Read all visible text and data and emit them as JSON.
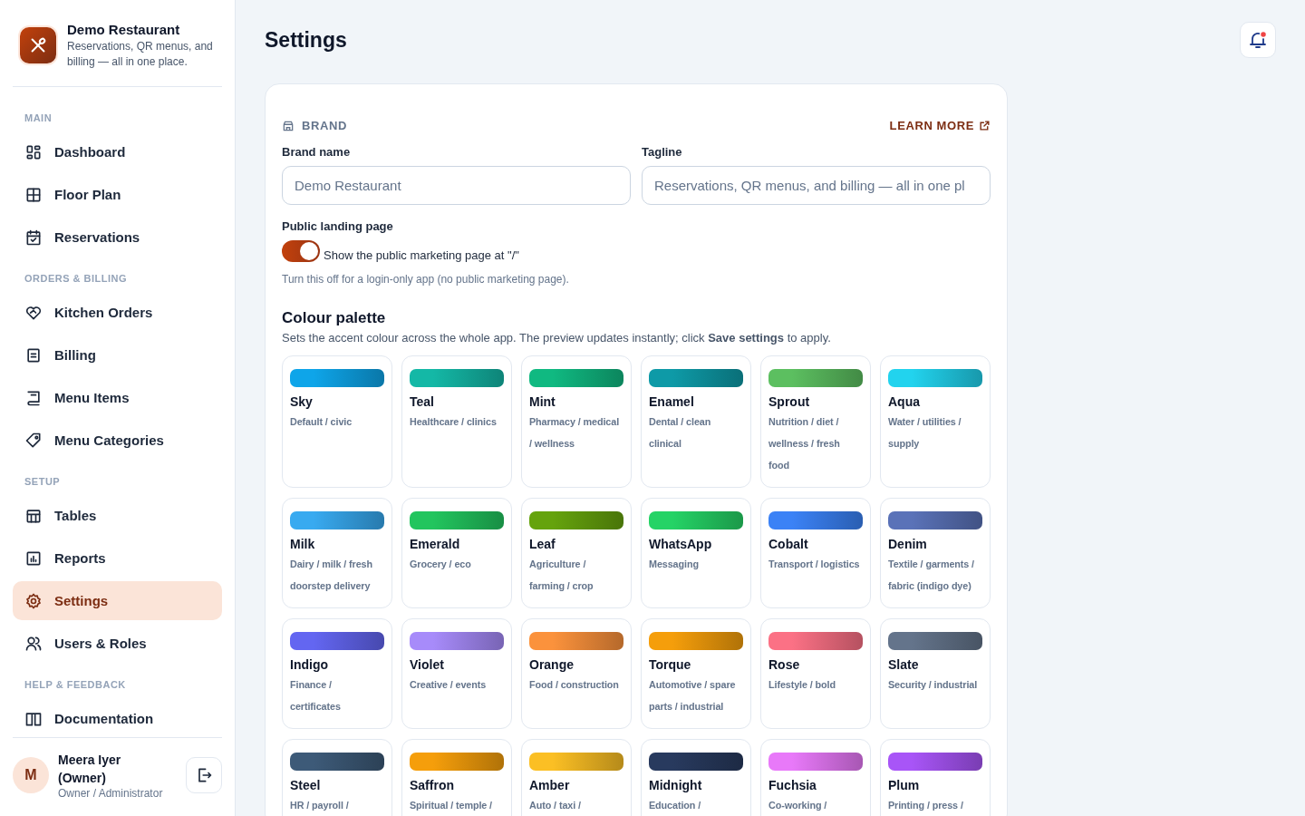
{
  "brand": {
    "name": "Demo Restaurant",
    "tagline": "Reservations, QR menus, and billing — all in one place."
  },
  "sidebar": {
    "sections": [
      {
        "title": "MAIN",
        "items": [
          {
            "label": "Dashboard",
            "selected": false
          },
          {
            "label": "Floor Plan",
            "selected": false
          },
          {
            "label": "Reservations",
            "selected": false
          }
        ]
      },
      {
        "title": "ORDERS & BILLING",
        "items": [
          {
            "label": "Kitchen Orders",
            "selected": false
          },
          {
            "label": "Billing",
            "selected": false
          },
          {
            "label": "Menu Items",
            "selected": false
          },
          {
            "label": "Menu Categories",
            "selected": false
          }
        ]
      },
      {
        "title": "SETUP",
        "items": [
          {
            "label": "Tables",
            "selected": false
          },
          {
            "label": "Reports",
            "selected": false
          },
          {
            "label": "Settings",
            "selected": true
          },
          {
            "label": "Users & Roles",
            "selected": false
          }
        ]
      },
      {
        "title": "HELP & FEEDBACK",
        "items": [
          {
            "label": "Documentation",
            "selected": false
          }
        ]
      }
    ]
  },
  "user": {
    "initial": "M",
    "name": "Meera Iyer (Owner)",
    "role": "Owner / Administrator"
  },
  "page_title": "Settings",
  "notifications": {
    "unread": true
  },
  "brand_section": {
    "title": "BRAND",
    "learn_more": "LEARN MORE",
    "fields": [
      {
        "label": "Brand name",
        "placeholder": "Demo Restaurant"
      },
      {
        "label": "Tagline",
        "placeholder": "Reservations, QR menus, and billing — all in one pl"
      }
    ],
    "landing": {
      "label": "Public landing page",
      "toggle_label": "Show the public marketing page at \"/\"",
      "on": true,
      "hint": "Turn this off for a login-only app (no public marketing page)."
    }
  },
  "palette": {
    "title": "Colour palette",
    "description": "Sets the accent colour across the whole app. The preview updates instantly; click **Save settings** to apply.",
    "items": [
      {
        "name": "Sky",
        "description": "Default / civic",
        "color": "#0ea5e9"
      },
      {
        "name": "Teal",
        "description": "Healthcare / clinics",
        "color": "#14b8a6"
      },
      {
        "name": "Mint",
        "description": "Pharmacy / medical / wellness",
        "color": "#10b981"
      },
      {
        "name": "Enamel",
        "description": "Dental / clean clinical",
        "color": "#0e9aa7"
      },
      {
        "name": "Sprout",
        "description": "Nutrition / diet / wellness / fresh food",
        "color": "#5cbf60"
      },
      {
        "name": "Aqua",
        "description": "Water / utilities / supply",
        "color": "#22d3ee"
      },
      {
        "name": "Milk",
        "description": "Dairy / milk / fresh doorstep delivery",
        "color": "#38aaf0"
      },
      {
        "name": "Emerald",
        "description": "Grocery / eco",
        "color": "#22c55e"
      },
      {
        "name": "Leaf",
        "description": "Agriculture / farming / crop",
        "color": "#65a30d"
      },
      {
        "name": "WhatsApp",
        "description": "Messaging",
        "color": "#25d366"
      },
      {
        "name": "Cobalt",
        "description": "Transport / logistics",
        "color": "#3b82f6"
      },
      {
        "name": "Denim",
        "description": "Textile / garments / fabric (indigo dye)",
        "color": "#5a72b8"
      },
      {
        "name": "Indigo",
        "description": "Finance / certificates",
        "color": "#6366f1"
      },
      {
        "name": "Violet",
        "description": "Creative / events",
        "color": "#a78bfa"
      },
      {
        "name": "Orange",
        "description": "Food / construction",
        "color": "#fb923c"
      },
      {
        "name": "Torque",
        "description": "Automotive / spare parts / industrial",
        "color": "#f59e0b"
      },
      {
        "name": "Rose",
        "description": "Lifestyle / bold",
        "color": "#fb7185"
      },
      {
        "name": "Slate",
        "description": "Security / industrial",
        "color": "#64748b"
      },
      {
        "name": "Steel",
        "description": "HR / payroll /",
        "color": "#3d5a78"
      },
      {
        "name": "Saffron",
        "description": "Spiritual / temple /",
        "color": "#f59e0b"
      },
      {
        "name": "Amber",
        "description": "Auto / taxi /",
        "color": "#fbbf24"
      },
      {
        "name": "Midnight",
        "description": "Education /",
        "color": "#283a5e"
      },
      {
        "name": "Fuchsia",
        "description": "Co-working /",
        "color": "#e879f9"
      },
      {
        "name": "Plum",
        "description": "Printing / press /",
        "color": "#a855f7"
      }
    ]
  }
}
